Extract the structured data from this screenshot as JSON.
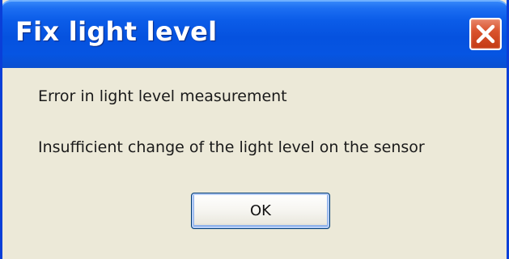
{
  "window": {
    "title": "Fix light level"
  },
  "title_bar": {
    "close_icon": "close-icon"
  },
  "message": {
    "line1": "Error in light level measurement",
    "line2": "Insufficient change of the light level on the sensor"
  },
  "buttons": {
    "ok_label": "OK"
  },
  "colors": {
    "titlebar": "#0552df",
    "body": "#ece9d8",
    "close_button": "#d9532d"
  }
}
